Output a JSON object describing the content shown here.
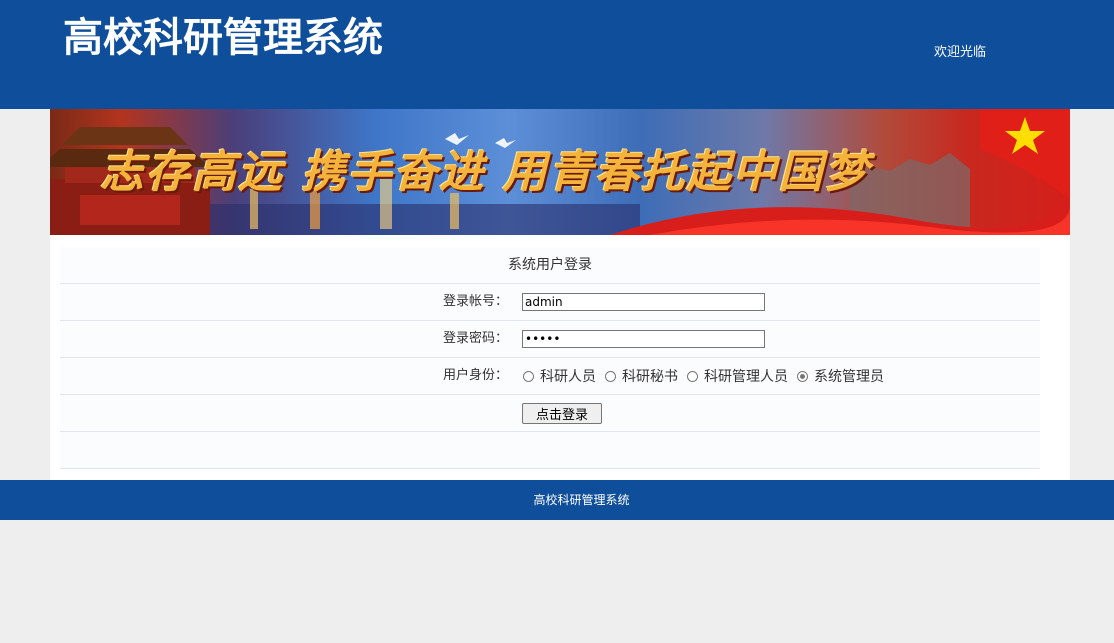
{
  "header": {
    "title": "高校科研管理系统",
    "welcome": "欢迎光临"
  },
  "banner": {
    "slogan": "志存高远  携手奋进  用青春托起中国梦"
  },
  "login": {
    "caption": "系统用户登录",
    "account_label": "登录帐号：",
    "account_value": "admin",
    "password_label": "登录密码：",
    "password_value": "•••••",
    "role_label": "用户身份：",
    "roles": [
      {
        "label": "科研人员",
        "checked": false
      },
      {
        "label": "科研秘书",
        "checked": false
      },
      {
        "label": "科研管理人员",
        "checked": false
      },
      {
        "label": "系统管理员",
        "checked": true
      }
    ],
    "submit_label": "点击登录"
  },
  "footer": {
    "copyright": "高校科研管理系统"
  },
  "colors": {
    "header_bg": "#0e4e9b",
    "page_bg": "#eeeeee",
    "slogan": "#f4b33a"
  }
}
